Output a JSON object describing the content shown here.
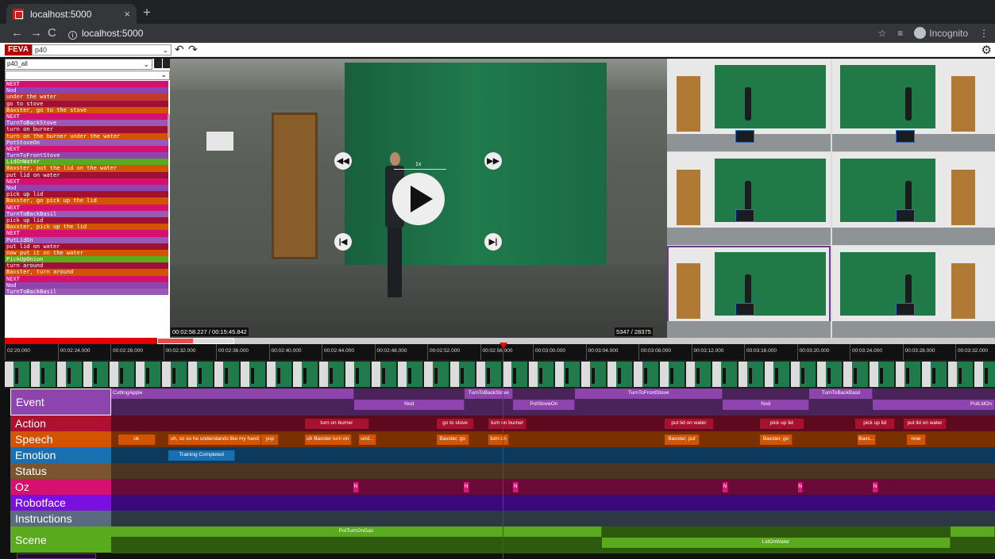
{
  "browser": {
    "tab_title": "localhost:5000",
    "tab_close": "×",
    "new_tab": "+",
    "url": "localhost:5000",
    "incognito": "Incognito"
  },
  "app": {
    "logo": "FEVA",
    "video_select": "p40",
    "annotation_set": "p40_all"
  },
  "annotations": [
    {
      "text": "NEXT",
      "color": "#d6106f"
    },
    {
      "text": "Nod",
      "color": "#8e44ad"
    },
    {
      "text": "under the water",
      "color": "#c0392b"
    },
    {
      "text": "go to stove",
      "color": "#a01030"
    },
    {
      "text": "Baxster, go to the stove",
      "color": "#d35400"
    },
    {
      "text": "NEXT",
      "color": "#d6106f"
    },
    {
      "text": "TurnToBackStove",
      "color": "#9b59b6"
    },
    {
      "text": "turn on burner",
      "color": "#a01030"
    },
    {
      "text": "turn on the burner under the water",
      "color": "#d35400"
    },
    {
      "text": "PotStoveOn",
      "color": "#9b59b6"
    },
    {
      "text": "NEXT",
      "color": "#d6106f"
    },
    {
      "text": "TurnToFrontStove",
      "color": "#8e44ad"
    },
    {
      "text": "LidOnWater",
      "color": "#5aaa1e"
    },
    {
      "text": "Baxster, put the lid on the water",
      "color": "#d35400"
    },
    {
      "text": "put lid on water",
      "color": "#a01030"
    },
    {
      "text": "NEXT",
      "color": "#d6106f"
    },
    {
      "text": "Nod",
      "color": "#8e44ad"
    },
    {
      "text": "pick up lid",
      "color": "#a01030"
    },
    {
      "text": "Baxster, go pick up the lid",
      "color": "#d35400"
    },
    {
      "text": "NEXT",
      "color": "#d6106f"
    },
    {
      "text": "TurnToBackBasil",
      "color": "#9b59b6"
    },
    {
      "text": "pick up lid",
      "color": "#a01030"
    },
    {
      "text": "Baxster, pick up the lid",
      "color": "#d35400"
    },
    {
      "text": "NEXT",
      "color": "#d6106f"
    },
    {
      "text": "PutLidOn",
      "color": "#9b59b6"
    },
    {
      "text": "put lid on water",
      "color": "#a01030"
    },
    {
      "text": "now put it on the water",
      "color": "#d35400"
    },
    {
      "text": "PickUpOnion",
      "color": "#5aaa1e"
    },
    {
      "text": "turn around",
      "color": "#a01030"
    },
    {
      "text": "Baxster, turn around",
      "color": "#d35400"
    },
    {
      "text": "NEXT",
      "color": "#d6106f"
    },
    {
      "text": "Nod",
      "color": "#8e44ad"
    },
    {
      "text": "TurnToBackBasil",
      "color": "#9b59b6"
    }
  ],
  "player": {
    "speed": "1x",
    "timecode": "00:02:58.227 / 00:15:45.842",
    "frames": "5347 / 28375",
    "progress": 0.19
  },
  "timeline": {
    "ticks": [
      "02:20.000",
      "00:02:24.000",
      "00:02:28.000",
      "00:02:32.000",
      "00:02:36.000",
      "00:02:40.000",
      "00:02:44.000",
      "00:02:48.000",
      "00:02:52.000",
      "00:02:56.000",
      "00:03:00.000",
      "00:03:04.000",
      "00:03:08.000",
      "00:03:12.000",
      "00:03:16.000",
      "00:03:20.000",
      "00:03:24.000",
      "00:03:28.000",
      "00:03:32.000"
    ],
    "tracks": [
      {
        "name": "Event",
        "color": "#8e44ad",
        "bg": "#4a235a"
      },
      {
        "name": "Action",
        "color": "#b01030",
        "bg": "#5c0a1c"
      },
      {
        "name": "Speech",
        "color": "#d35400",
        "bg": "#7a3000"
      },
      {
        "name": "Emotion",
        "color": "#1a6fb0",
        "bg": "#0d3a5c"
      },
      {
        "name": "Status",
        "color": "#7a5530",
        "bg": "#4a3520"
      },
      {
        "name": "Oz",
        "color": "#d6106f",
        "bg": "#6a0838"
      },
      {
        "name": "Robotface",
        "color": "#7a10e0",
        "bg": "#3a0878"
      },
      {
        "name": "Instructions",
        "color": "#5a6b80",
        "bg": "#2e3844"
      },
      {
        "name": "Scene",
        "color": "#5aaa1e",
        "bg": "#2e5a10"
      }
    ],
    "segments": {
      "event": [
        {
          "label": "CuttingApple",
          "row": 0,
          "start": 0,
          "end": 0.275
        },
        {
          "label": "Nod",
          "row": 1,
          "start": 0.275,
          "end": 0.4
        },
        {
          "label": "TurnToBackStove",
          "row": 0,
          "start": 0.4,
          "end": 0.455
        },
        {
          "label": "PotStoveOn",
          "row": 1,
          "start": 0.455,
          "end": 0.525
        },
        {
          "label": "TurnToFrontStove",
          "row": 0,
          "start": 0.525,
          "end": 0.692
        },
        {
          "label": "Nod",
          "row": 1,
          "start": 0.692,
          "end": 0.79
        },
        {
          "label": "TurnToBackBasil",
          "row": 0,
          "start": 0.79,
          "end": 0.862
        },
        {
          "label": "PutLidOn",
          "row": 1,
          "start": 0.862,
          "end": 1
        }
      ],
      "action": [
        {
          "label": "turn on burner",
          "start": 0.219,
          "end": 0.292
        },
        {
          "label": "go to stove",
          "start": 0.368,
          "end": 0.411
        },
        {
          "label": "turn on burner",
          "start": 0.427,
          "end": 0.47
        },
        {
          "label": "put lid on water",
          "start": 0.626,
          "end": 0.682
        },
        {
          "label": "pick up lid",
          "start": 0.734,
          "end": 0.784
        },
        {
          "label": "pick up lid",
          "start": 0.842,
          "end": 0.887
        },
        {
          "label": "put lid on water",
          "start": 0.897,
          "end": 0.945
        }
      ],
      "speech": [
        {
          "label": "ok",
          "start": 0.008,
          "end": 0.05
        },
        {
          "label": "uh, so so he understands like my hand",
          "start": 0.065,
          "end": 0.17
        },
        {
          "label": "yup",
          "start": 0.17,
          "end": 0.19
        },
        {
          "label": "uh Baxster turn on",
          "start": 0.219,
          "end": 0.272
        },
        {
          "label": "und...",
          "start": 0.28,
          "end": 0.3
        },
        {
          "label": "Baxster, go",
          "start": 0.368,
          "end": 0.405
        },
        {
          "label": "turn on",
          "start": 0.427,
          "end": 0.45
        },
        {
          "label": "Baxster, put",
          "start": 0.626,
          "end": 0.666
        },
        {
          "label": "Baxster, go",
          "start": 0.734,
          "end": 0.771
        },
        {
          "label": "Baxs...",
          "start": 0.845,
          "end": 0.865
        },
        {
          "label": "now",
          "start": 0.9,
          "end": 0.922
        }
      ],
      "emotion": [
        {
          "label": "Training Completed",
          "start": 0.065,
          "end": 0.14
        }
      ],
      "oz": [
        {
          "label": "N",
          "start": 0.274,
          "end": 0.28
        },
        {
          "label": "N",
          "start": 0.399,
          "end": 0.405
        },
        {
          "label": "N",
          "start": 0.455,
          "end": 0.461
        },
        {
          "label": "N",
          "start": 0.692,
          "end": 0.698
        },
        {
          "label": "N",
          "start": 0.777,
          "end": 0.783
        },
        {
          "label": "N",
          "start": 0.862,
          "end": 0.868
        }
      ],
      "scene": [
        {
          "label": "PotTurnOnGas",
          "row": 0,
          "start": 0,
          "end": 0.555
        },
        {
          "label": "LidOnWater",
          "row": 1,
          "start": 0.555,
          "end": 0.95
        },
        {
          "label": "",
          "row": 0,
          "start": 0.95,
          "end": 1
        }
      ]
    },
    "playhead": 0.443
  }
}
